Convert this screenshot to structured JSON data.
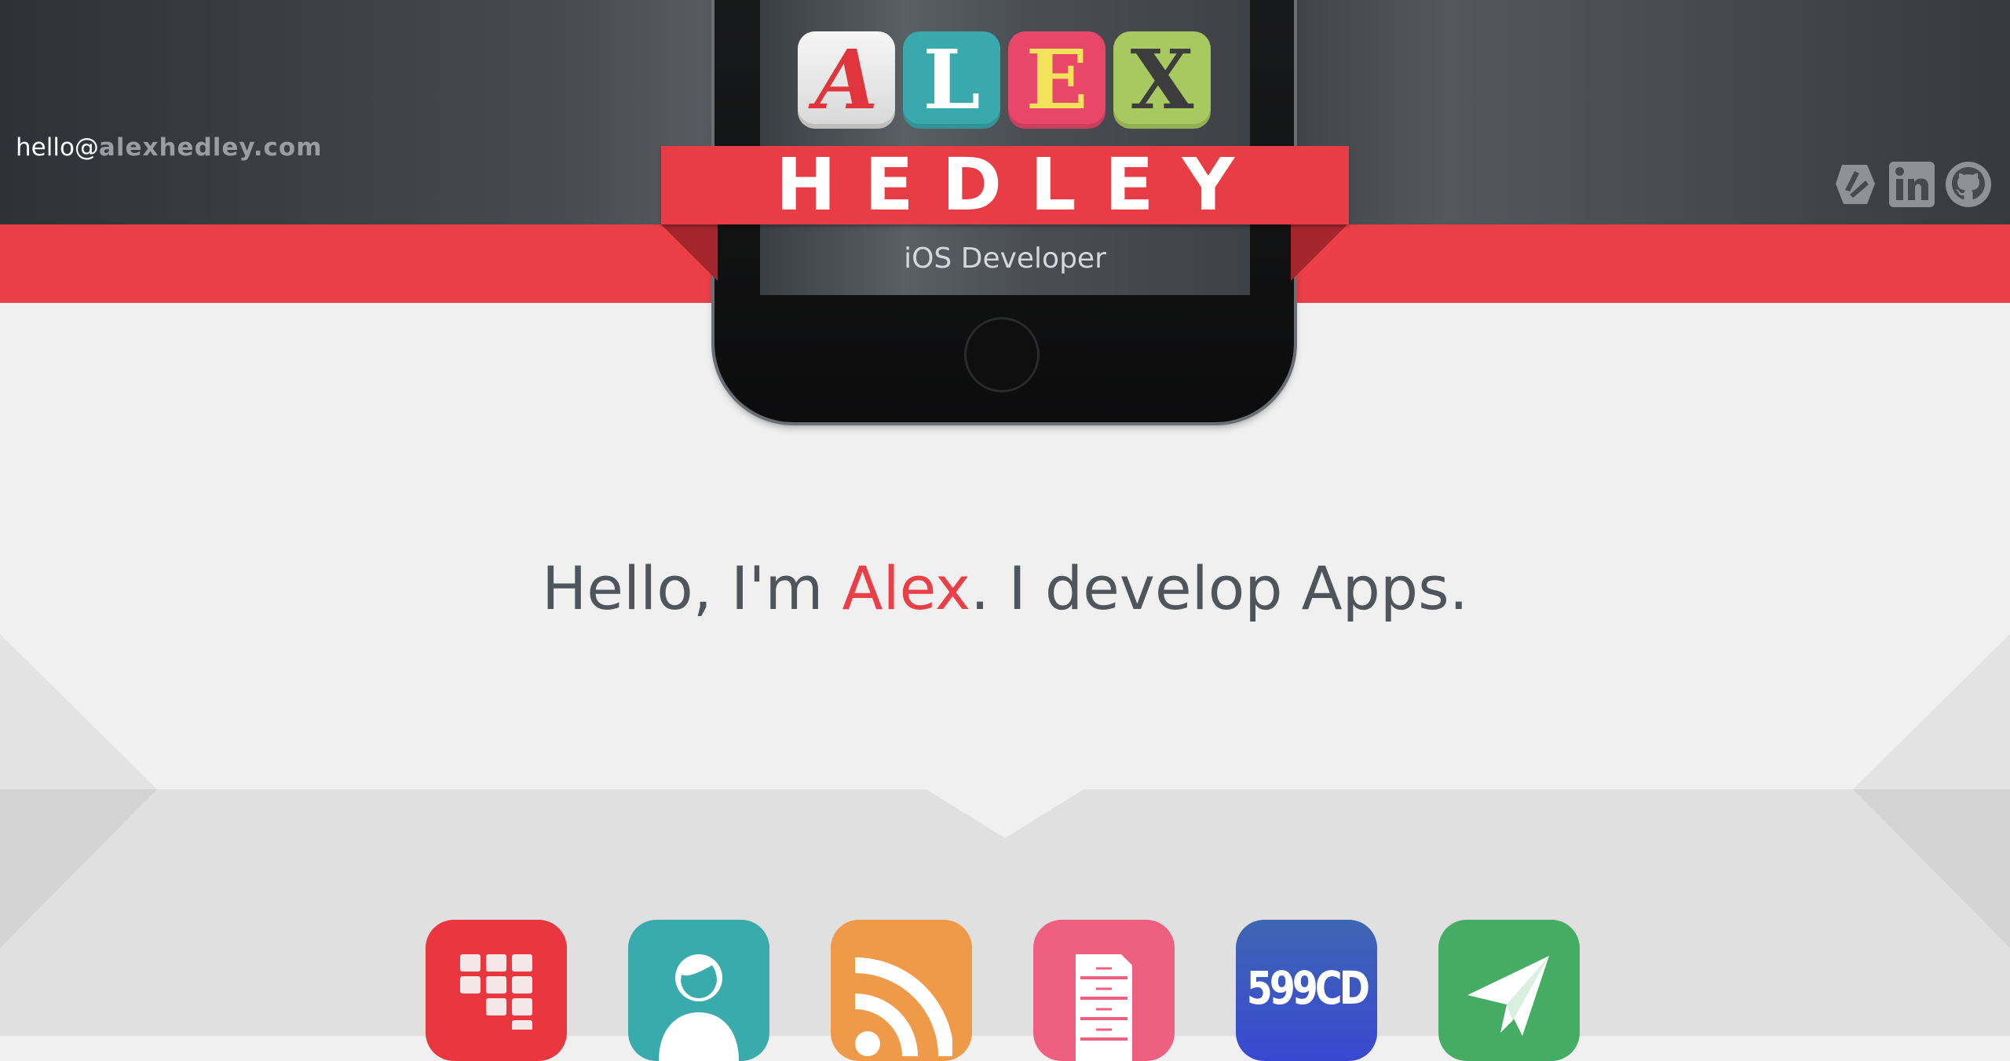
{
  "header": {
    "email_user": "hello@",
    "email_domain": "alexhedley.com",
    "logo_letters": [
      "A",
      "L",
      "E",
      "X"
    ],
    "ribbon_text": "HEDLEY",
    "subtitle": "iOS Developer",
    "social_icons": [
      "stackoverflow-icon",
      "linkedin-icon",
      "github-icon"
    ]
  },
  "hero": {
    "before": "Hello, I'm ",
    "name": "Alex",
    "after": ". I develop Apps."
  },
  "apps": {
    "icons": [
      "grid-icon",
      "person-icon",
      "rss-icon",
      "filing-cabinet-icon",
      "599cd-logo",
      "paper-plane-icon"
    ],
    "brand_text": "599CD"
  },
  "colors": {
    "accent_red": "#ea3f47",
    "header_dark": "#3b3e42",
    "background": "#f0f0f0",
    "lower_band": "#e0e0e0",
    "teal": "#3aabad",
    "orange": "#ef9a48",
    "pink": "#ee5f80",
    "blue": "#3948d1",
    "green": "#45ad63"
  }
}
